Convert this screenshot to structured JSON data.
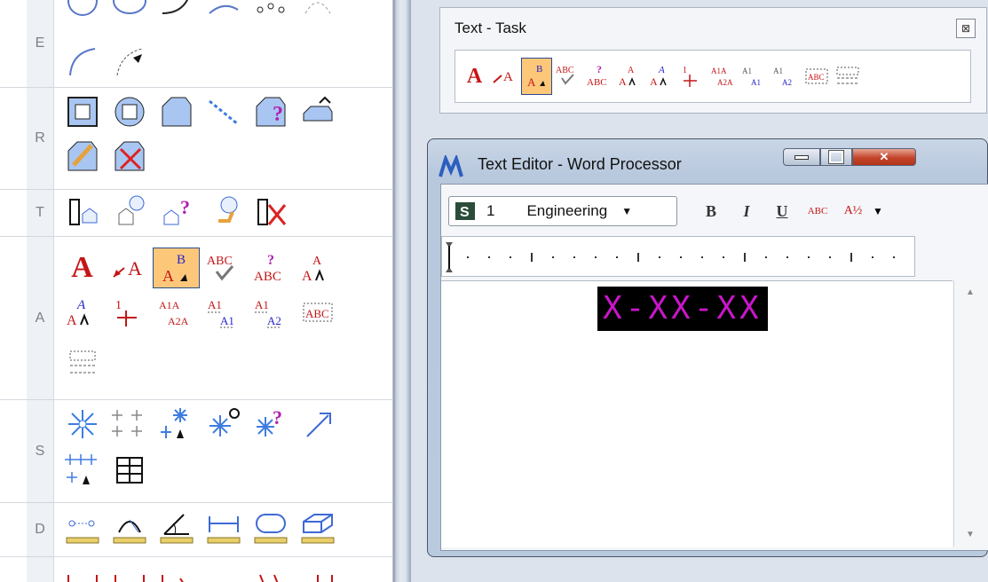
{
  "palette": {
    "sections": [
      {
        "label": "E"
      },
      {
        "label": "R"
      },
      {
        "label": "T"
      },
      {
        "label": "A"
      },
      {
        "label": "S"
      },
      {
        "label": "D"
      }
    ]
  },
  "text_task": {
    "title": "Text - Task",
    "close_glyph": "⊠",
    "tools": [
      "place-text",
      "place-note",
      "edit-text",
      "spell-checker",
      "find-replace-text",
      "change-text-attributes",
      "copy-increment-text",
      "display-text-attributes",
      "copy-enter-data-field",
      "fill-enter-data-field",
      "auto-fill-enter-data-fields",
      "text-node",
      "enter-data-field"
    ]
  },
  "text_editor": {
    "title": "Text Editor - Word Processor",
    "style_index": "1",
    "style_name": "Engineering",
    "bold": "B",
    "italic": "I",
    "underline": "U",
    "spell": "ABC",
    "stacked_fraction": "A½",
    "content": "X-XX-XX"
  },
  "colors": {
    "active_tool": "#fdc77a",
    "content_text": "#c916c9",
    "content_bg": "#000000"
  }
}
